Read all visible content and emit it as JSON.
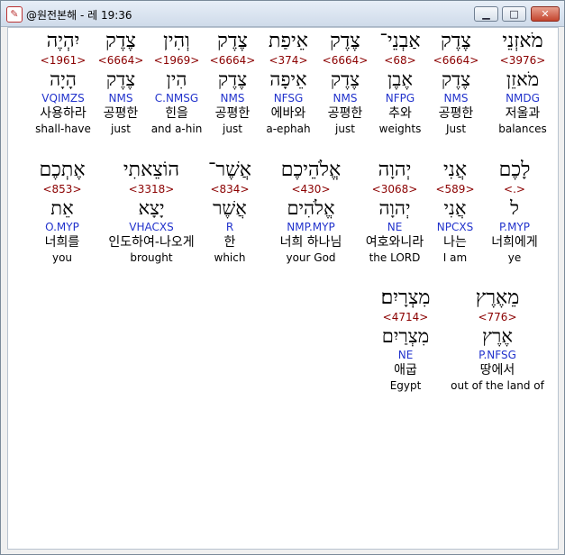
{
  "window": {
    "title": "@원전본해 - 레 19:36",
    "icon": "app-logo-icon",
    "min_icon": "minimize-icon",
    "max_icon": "maximize-icon",
    "close_icon": "close-icon"
  },
  "rows": [
    [
      {
        "heb": "מֹאזְנֵי",
        "strong": "<3976>",
        "heb2": "מֹאזֵן",
        "morph": "NMDG",
        "kor": "저울과",
        "eng": "balances",
        "selected": true
      },
      {
        "heb": "צֶדֶק",
        "strong": "<6664>",
        "heb2": "צֶדֶק",
        "morph": "NMS",
        "kor": "공평한",
        "eng": "Just"
      },
      {
        "heb": "אַבְנֵי־",
        "strong": "<68>",
        "heb2": "אֶבֶן",
        "morph": "NFPG",
        "kor": "추와",
        "eng": "weights"
      },
      {
        "heb": "צֶדֶק",
        "strong": "<6664>",
        "heb2": "צֶדֶק",
        "morph": "NMS",
        "kor": "공평한",
        "eng": "just"
      },
      {
        "heb": "אֵיפַת",
        "strong": "<374>",
        "heb2": "אֵיפָה",
        "morph": "NFSG",
        "kor": "에바와",
        "eng": "a-ephah"
      },
      {
        "heb": "צֶדֶק",
        "strong": "<6664>",
        "heb2": "צֶדֶק",
        "morph": "NMS",
        "kor": "공평한",
        "eng": "just"
      },
      {
        "heb": "וְהִין",
        "strong": "<1969>",
        "heb2": "הִין",
        "morph": "C.NMSG",
        "kor": "힌을",
        "eng": "and a-hin"
      },
      {
        "heb": "צֶדֶק",
        "strong": "<6664>",
        "heb2": "צֶדֶק",
        "morph": "NMS",
        "kor": "공평한",
        "eng": "just"
      },
      {
        "heb": "יִהְיֶה",
        "strong": "<1961>",
        "heb2": "הָיָה",
        "morph": "VQIMZS",
        "kor": "사용하라",
        "eng": "shall-have"
      }
    ],
    [
      {
        "heb": "לָכֶם",
        "strong": "<.>",
        "heb2": "ל",
        "morph": "P.MYP",
        "kor": "너희에게",
        "eng": "ye"
      },
      {
        "heb": "אֲנִי",
        "strong": "<589>",
        "heb2": "אֲנִי",
        "morph": "NPCXS",
        "kor": "나는",
        "eng": "I am"
      },
      {
        "heb": "יְהוָה",
        "strong": "<3068>",
        "heb2": "יְהוָה",
        "morph": "NE",
        "kor": "여호와니라",
        "eng": "the LORD"
      },
      {
        "heb": "אֱלֹהֵיכֶם",
        "strong": "<430>",
        "heb2": "אֱלֹהִים",
        "morph": "NMP.MYP",
        "kor": "너희 하나님",
        "eng": "your God"
      },
      {
        "heb": "אֲשֶׁר־",
        "strong": "<834>",
        "heb2": "אֲשֶׁר",
        "morph": "R",
        "kor": "한",
        "eng": "which"
      },
      {
        "heb": "הוֹצֵאתִי",
        "strong": "<3318>",
        "heb2": "יָצָא",
        "morph": "VHACXS",
        "kor": "인도하여-나오게",
        "eng": "brought"
      },
      {
        "heb": "אֶתְכֶם",
        "strong": "<853>",
        "heb2": "אֵת",
        "morph": "O.MYP",
        "kor": "너희를",
        "eng": "you"
      }
    ],
    [
      {
        "heb": "מֵאֶרֶץ",
        "strong": "<776>",
        "heb2": "אֶרֶץ",
        "morph": "P.NFSG",
        "kor": "땅에서",
        "eng": "out of the land of"
      },
      {
        "heb": "מִצְרָיִם׃",
        "strong": "<4714>",
        "heb2": "מִצְרַיִם",
        "morph": "NE",
        "kor": "애굽",
        "eng": "Egypt"
      }
    ]
  ]
}
